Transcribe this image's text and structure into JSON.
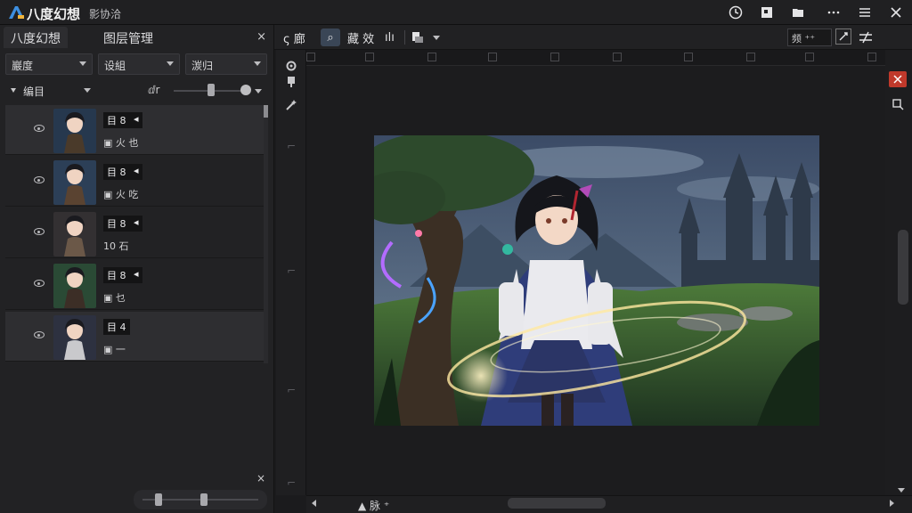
{
  "app": {
    "title": "八度幻想",
    "subtitle": "影协洽"
  },
  "window_controls": {
    "history_icon": "clock-icon",
    "pages_icon": "pages-icon",
    "folder_icon": "folder-icon",
    "more_icon": "more-icon",
    "menu_icon": "hamburger-icon",
    "close_icon": "close-icon"
  },
  "left_panel": {
    "tabs": [
      {
        "label": "八度幻想"
      },
      {
        "label": "图层管理"
      }
    ],
    "close_label": "×",
    "dropdowns": [
      {
        "value": "巖度"
      },
      {
        "value": "设組"
      },
      {
        "value": "湠归"
      }
    ],
    "group_label": "编目",
    "opacity_label": "ⅆr",
    "opacity_value": 0.45,
    "layers": [
      {
        "name": "目 8",
        "badge": "◂",
        "sub": "▣ 火 也",
        "selected": true,
        "thumb_colors": [
          "#26384e",
          "#4a3a2a"
        ]
      },
      {
        "name": "目 8",
        "badge": "◂",
        "sub": "▣ 火 吃",
        "selected": false,
        "thumb_colors": [
          "#2c3f57",
          "#5a4331"
        ]
      },
      {
        "name": "目 8",
        "badge": "◂",
        "sub": "10 石",
        "selected": false,
        "thumb_colors": [
          "#333032",
          "#6b5848"
        ]
      },
      {
        "name": "目 8",
        "badge": "◂",
        "sub": "▣ 乜",
        "selected": false,
        "thumb_colors": [
          "#2a4a35",
          "#3c2e26"
        ]
      },
      {
        "name": "目 4",
        "badge": "",
        "sub": "▣ 一",
        "selected": true,
        "thumb_colors": [
          "#2d3140",
          "#c9c9cc"
        ]
      }
    ],
    "bottom_close": "×",
    "zoom_value": 0.5
  },
  "toolbar": {
    "items": [
      {
        "label": "ς 廊",
        "active": false
      },
      {
        "label": "⌕",
        "active": true
      },
      {
        "label": "藏 效",
        "active": false
      },
      {
        "label": "ılı",
        "active": false
      }
    ],
    "layer_menu_icon": "layers-icon",
    "right_box": "频 ⁺⁺",
    "right_edit_icon": "edit-icon",
    "right_adjust_icon": "adjust-icon"
  },
  "vtoolbar": {
    "icons": [
      "gear-icon",
      "brush-icon",
      "wand-icon",
      "ruler-icon",
      "ruler-icon",
      "ruler-icon",
      "ruler-icon"
    ]
  },
  "canvas": {
    "image_alt": "anime mage girl in fantasy landscape"
  },
  "right_strip": {
    "close_icon": "close-icon",
    "crop_icon": "crop-icon"
  },
  "status": {
    "text": "▲ 脉 ⁺"
  },
  "colors": {
    "accent": "#3a6ea5",
    "close_red": "#c0392b"
  }
}
